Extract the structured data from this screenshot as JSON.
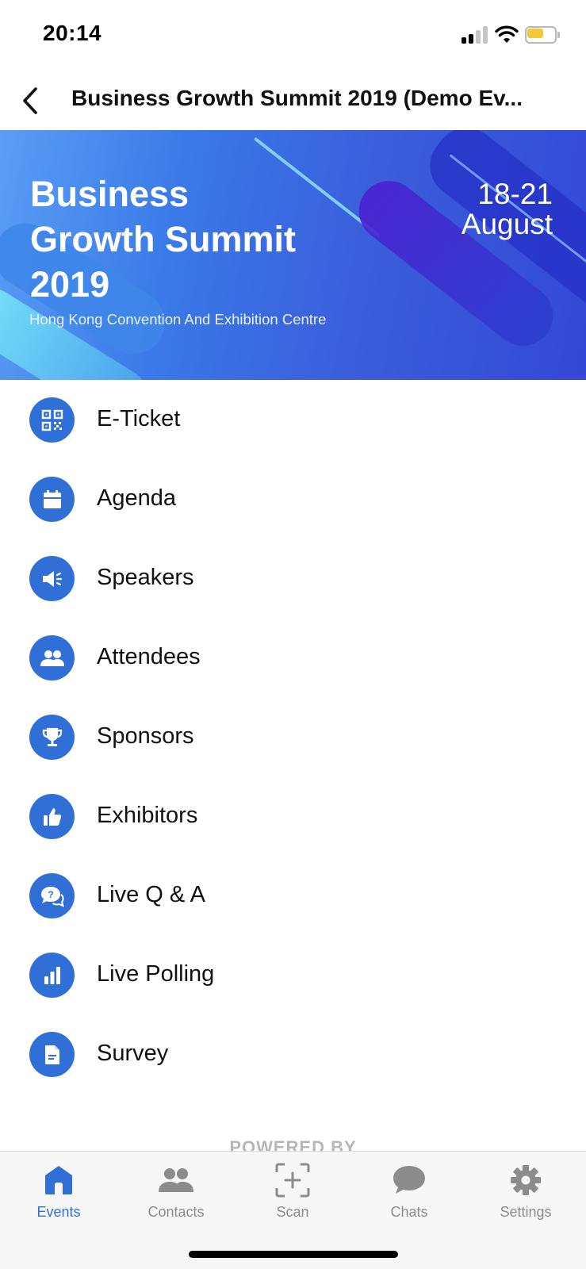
{
  "status_bar": {
    "time": "20:14"
  },
  "nav": {
    "title": "Business Growth Summit 2019 (Demo Ev..."
  },
  "banner": {
    "title_line1": "Business",
    "title_line2": "Growth Summit",
    "title_line3": "2019",
    "venue": "Hong Kong Convention And Exhibition Centre",
    "date_line1": "18-21",
    "date_line2": "August"
  },
  "menu": {
    "items": [
      {
        "label": "E-Ticket",
        "icon": "qr-code-icon"
      },
      {
        "label": "Agenda",
        "icon": "calendar-icon"
      },
      {
        "label": "Speakers",
        "icon": "megaphone-icon"
      },
      {
        "label": "Attendees",
        "icon": "people-icon"
      },
      {
        "label": "Sponsors",
        "icon": "trophy-icon"
      },
      {
        "label": "Exhibitors",
        "icon": "thumbs-up-icon"
      },
      {
        "label": "Live Q & A",
        "icon": "question-chat-icon"
      },
      {
        "label": "Live Polling",
        "icon": "bar-chart-icon"
      },
      {
        "label": "Survey",
        "icon": "document-icon"
      }
    ]
  },
  "footer": {
    "powered_by": "POWERED BY"
  },
  "tab_bar": {
    "tabs": [
      {
        "label": "Events",
        "icon": "home-icon",
        "active": true
      },
      {
        "label": "Contacts",
        "icon": "contacts-icon",
        "active": false
      },
      {
        "label": "Scan",
        "icon": "scan-icon",
        "active": false
      },
      {
        "label": "Chats",
        "icon": "chat-bubble-icon",
        "active": false
      },
      {
        "label": "Settings",
        "icon": "gear-icon",
        "active": false
      }
    ]
  },
  "colors": {
    "accent": "#2f6fd6",
    "tab_inactive": "#8c8c8c",
    "battery": "#f3c83a"
  }
}
